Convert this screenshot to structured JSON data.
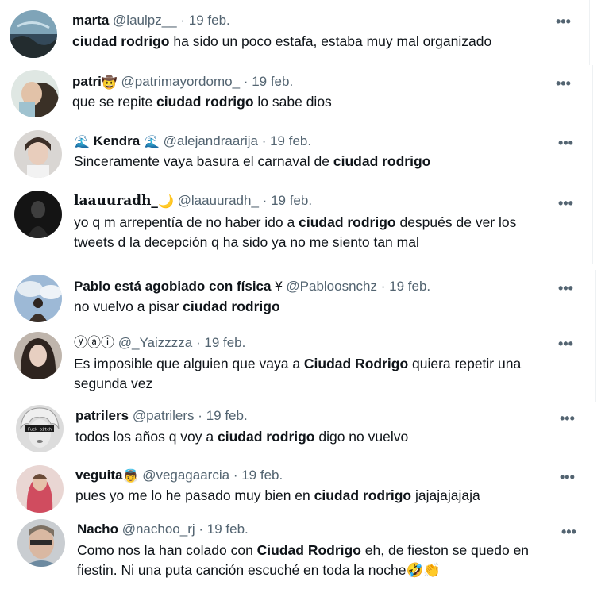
{
  "tweets": [
    {
      "name": "marta",
      "name_emoji": "",
      "handle": "@laulpz__",
      "date": "19 feb.",
      "pre": "",
      "keyword": "ciudad rodrigo",
      "post": " ha sido un poco estafa, estaba muy mal organizado"
    },
    {
      "name": "patri",
      "name_emoji": "🤠",
      "handle": "@patrimayordomo_",
      "date": "19 feb.",
      "pre": "que se repite ",
      "keyword": "ciudad rodrigo",
      "post": " lo sabe dios"
    },
    {
      "name": "Kendra",
      "name_prefix_emoji": "🌊",
      "name_emoji": "🌊",
      "handle": "@alejandraarija",
      "date": "19 feb.",
      "pre": "Sinceramente vaya basura el carnaval de ",
      "keyword": "ciudad rodrigo",
      "post": ""
    },
    {
      "name": "laauuradh_",
      "name_emoji": "🌙",
      "handle": "@laauuradh_",
      "date": "19 feb.",
      "pre": "yo q m arrepentía de no haber ido a ",
      "keyword": "ciudad rodrigo",
      "post": " después de ver los\ntweets d la decepción q ha sido ya no me siento tan mal"
    },
    {
      "name": "Pablo está agobiado con física",
      "name_emoji": "Ұ",
      "handle": "@Pabloosnchz",
      "date": "19 feb.",
      "pre": "no vuelvo a pisar ",
      "keyword": "ciudad rodrigo",
      "post": ""
    },
    {
      "name": "ⓨⓐⓘ",
      "name_emoji": "",
      "handle": "@_Yaizzzza",
      "date": "19 feb.",
      "pre": "Es imposible que alguien que vaya a ",
      "keyword": "Ciudad Rodrigo",
      "post": " quiera repetir una\nsegunda vez"
    },
    {
      "name": "patrilers",
      "name_emoji": "",
      "handle": "@patrilers",
      "date": "19 feb.",
      "pre": "todos los años q voy a ",
      "keyword": "ciudad rodrigo",
      "post": " digo no vuelvo"
    },
    {
      "name": "veguita",
      "name_emoji": "👼",
      "handle": "@vegagaarcia",
      "date": "19 feb.",
      "pre": "pues yo me lo he pasado muy bien en ",
      "keyword": "ciudad rodrigo",
      "post": " jajajajajaja"
    },
    {
      "name": "Nacho",
      "name_emoji": "",
      "handle": "@nachoo_rj",
      "date": "19 feb.",
      "pre": "Como nos la han colado con ",
      "keyword": "Ciudad Rodrigo",
      "post": " eh, de fieston se quedo en\nfiestin. Ni una puta canción escuché en toda la noche🤣👏"
    }
  ],
  "separator": "·",
  "more_label": "•••",
  "avatar_text_patrilers": "Fuck bitch",
  "colors": {
    "text": "#0f1419",
    "muted": "#536471",
    "divider": "#e6eaed"
  }
}
